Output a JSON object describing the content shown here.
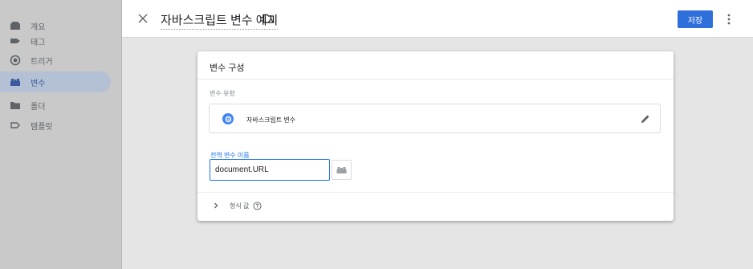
{
  "sidebar": {
    "items": [
      {
        "label": "개요",
        "icon": "overview-icon",
        "active": false
      },
      {
        "label": "태그",
        "icon": "tag-icon",
        "active": false
      },
      {
        "label": "트리거",
        "icon": "trigger-icon",
        "active": false
      },
      {
        "label": "변수",
        "icon": "variables-icon",
        "active": true
      },
      {
        "label": "폴더",
        "icon": "folder-icon",
        "active": false
      },
      {
        "label": "템플릿",
        "icon": "template-icon",
        "active": false
      }
    ]
  },
  "header": {
    "title": "자바스크립트 변수 예시",
    "save_label": "저장",
    "accent_color": "#2f6fdc"
  },
  "card": {
    "title": "변수 구성",
    "type_section_label": "변수 유형",
    "type_value": "자바스크립트 변수",
    "var_name_label": "전역 변수 이름",
    "var_name_value": "document.URL",
    "format_label": "형식 값"
  }
}
